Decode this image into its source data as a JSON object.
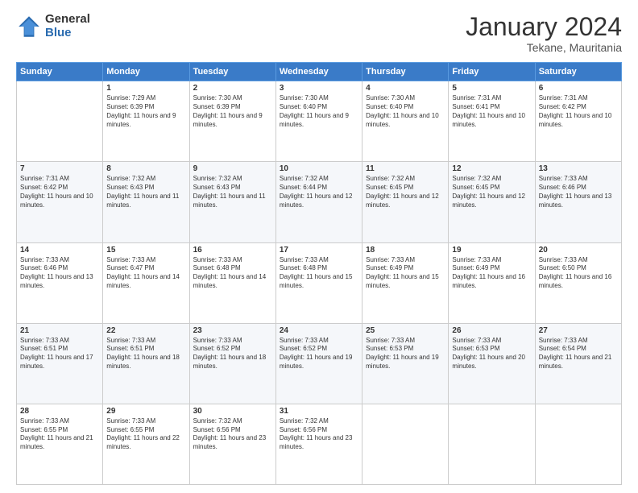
{
  "logo": {
    "general": "General",
    "blue": "Blue"
  },
  "header": {
    "title": "January 2024",
    "location": "Tekane, Mauritania"
  },
  "days_of_week": [
    "Sunday",
    "Monday",
    "Tuesday",
    "Wednesday",
    "Thursday",
    "Friday",
    "Saturday"
  ],
  "weeks": [
    [
      {
        "day": "",
        "info": ""
      },
      {
        "day": "1",
        "info": "Sunrise: 7:29 AM\nSunset: 6:39 PM\nDaylight: 11 hours and 9 minutes."
      },
      {
        "day": "2",
        "info": "Sunrise: 7:30 AM\nSunset: 6:39 PM\nDaylight: 11 hours and 9 minutes."
      },
      {
        "day": "3",
        "info": "Sunrise: 7:30 AM\nSunset: 6:40 PM\nDaylight: 11 hours and 9 minutes."
      },
      {
        "day": "4",
        "info": "Sunrise: 7:30 AM\nSunset: 6:40 PM\nDaylight: 11 hours and 10 minutes."
      },
      {
        "day": "5",
        "info": "Sunrise: 7:31 AM\nSunset: 6:41 PM\nDaylight: 11 hours and 10 minutes."
      },
      {
        "day": "6",
        "info": "Sunrise: 7:31 AM\nSunset: 6:42 PM\nDaylight: 11 hours and 10 minutes."
      }
    ],
    [
      {
        "day": "7",
        "info": "Sunrise: 7:31 AM\nSunset: 6:42 PM\nDaylight: 11 hours and 10 minutes."
      },
      {
        "day": "8",
        "info": "Sunrise: 7:32 AM\nSunset: 6:43 PM\nDaylight: 11 hours and 11 minutes."
      },
      {
        "day": "9",
        "info": "Sunrise: 7:32 AM\nSunset: 6:43 PM\nDaylight: 11 hours and 11 minutes."
      },
      {
        "day": "10",
        "info": "Sunrise: 7:32 AM\nSunset: 6:44 PM\nDaylight: 11 hours and 12 minutes."
      },
      {
        "day": "11",
        "info": "Sunrise: 7:32 AM\nSunset: 6:45 PM\nDaylight: 11 hours and 12 minutes."
      },
      {
        "day": "12",
        "info": "Sunrise: 7:32 AM\nSunset: 6:45 PM\nDaylight: 11 hours and 12 minutes."
      },
      {
        "day": "13",
        "info": "Sunrise: 7:33 AM\nSunset: 6:46 PM\nDaylight: 11 hours and 13 minutes."
      }
    ],
    [
      {
        "day": "14",
        "info": "Sunrise: 7:33 AM\nSunset: 6:46 PM\nDaylight: 11 hours and 13 minutes."
      },
      {
        "day": "15",
        "info": "Sunrise: 7:33 AM\nSunset: 6:47 PM\nDaylight: 11 hours and 14 minutes."
      },
      {
        "day": "16",
        "info": "Sunrise: 7:33 AM\nSunset: 6:48 PM\nDaylight: 11 hours and 14 minutes."
      },
      {
        "day": "17",
        "info": "Sunrise: 7:33 AM\nSunset: 6:48 PM\nDaylight: 11 hours and 15 minutes."
      },
      {
        "day": "18",
        "info": "Sunrise: 7:33 AM\nSunset: 6:49 PM\nDaylight: 11 hours and 15 minutes."
      },
      {
        "day": "19",
        "info": "Sunrise: 7:33 AM\nSunset: 6:49 PM\nDaylight: 11 hours and 16 minutes."
      },
      {
        "day": "20",
        "info": "Sunrise: 7:33 AM\nSunset: 6:50 PM\nDaylight: 11 hours and 16 minutes."
      }
    ],
    [
      {
        "day": "21",
        "info": "Sunrise: 7:33 AM\nSunset: 6:51 PM\nDaylight: 11 hours and 17 minutes."
      },
      {
        "day": "22",
        "info": "Sunrise: 7:33 AM\nSunset: 6:51 PM\nDaylight: 11 hours and 18 minutes."
      },
      {
        "day": "23",
        "info": "Sunrise: 7:33 AM\nSunset: 6:52 PM\nDaylight: 11 hours and 18 minutes."
      },
      {
        "day": "24",
        "info": "Sunrise: 7:33 AM\nSunset: 6:52 PM\nDaylight: 11 hours and 19 minutes."
      },
      {
        "day": "25",
        "info": "Sunrise: 7:33 AM\nSunset: 6:53 PM\nDaylight: 11 hours and 19 minutes."
      },
      {
        "day": "26",
        "info": "Sunrise: 7:33 AM\nSunset: 6:53 PM\nDaylight: 11 hours and 20 minutes."
      },
      {
        "day": "27",
        "info": "Sunrise: 7:33 AM\nSunset: 6:54 PM\nDaylight: 11 hours and 21 minutes."
      }
    ],
    [
      {
        "day": "28",
        "info": "Sunrise: 7:33 AM\nSunset: 6:55 PM\nDaylight: 11 hours and 21 minutes."
      },
      {
        "day": "29",
        "info": "Sunrise: 7:33 AM\nSunset: 6:55 PM\nDaylight: 11 hours and 22 minutes."
      },
      {
        "day": "30",
        "info": "Sunrise: 7:32 AM\nSunset: 6:56 PM\nDaylight: 11 hours and 23 minutes."
      },
      {
        "day": "31",
        "info": "Sunrise: 7:32 AM\nSunset: 6:56 PM\nDaylight: 11 hours and 23 minutes."
      },
      {
        "day": "",
        "info": ""
      },
      {
        "day": "",
        "info": ""
      },
      {
        "day": "",
        "info": ""
      }
    ]
  ]
}
